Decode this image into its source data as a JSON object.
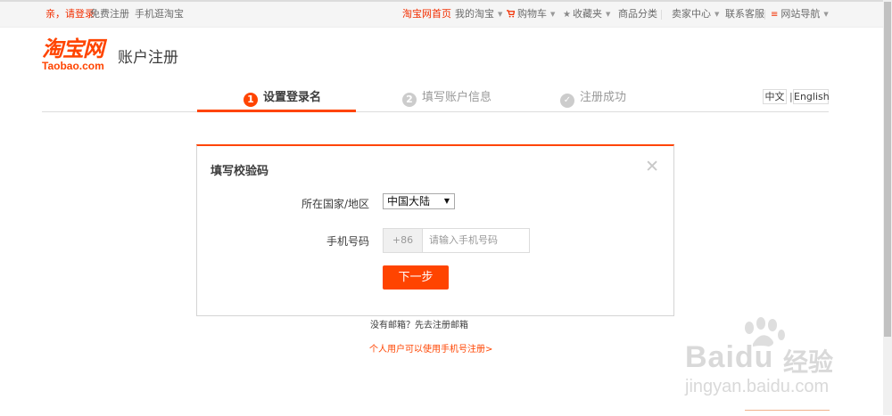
{
  "topbar": {
    "login": "亲，请登录",
    "register": "免费注册",
    "mobile": "手机逛淘宝",
    "home": "淘宝网首页",
    "my_taobao": "我的淘宝",
    "cart": "购物车",
    "favorites": "收藏夹",
    "categories": "商品分类",
    "seller": "卖家中心",
    "service": "联系客服",
    "sitenav": "网站导航"
  },
  "logo": {
    "cn": "淘宝网",
    "en": "Taobao.com",
    "title": "账户注册"
  },
  "steps": [
    {
      "num": "1",
      "label": "设置登录名"
    },
    {
      "num": "2",
      "label": "填写账户信息"
    },
    {
      "num": "✓",
      "label": "注册成功"
    }
  ],
  "lang": {
    "zh": "中文",
    "sep": "|",
    "en": "English"
  },
  "dialog": {
    "title": "填写校验码",
    "close": "✕",
    "country_label": "所在国家/地区",
    "country_value": "中国大陆",
    "phone_label": "手机号码",
    "phone_prefix": "+86",
    "phone_placeholder": "请输入手机号码",
    "next": "下一步"
  },
  "links": {
    "no_email": "没有邮箱？先去注册邮箱",
    "personal": "个人用户可以使用手机号注册>"
  },
  "watermark": {
    "text": "Baidu",
    "cn": "经验",
    "url": "jingyan.baidu.com"
  },
  "colors": {
    "accent": "#ff4400",
    "text": "#3c3c3c"
  }
}
